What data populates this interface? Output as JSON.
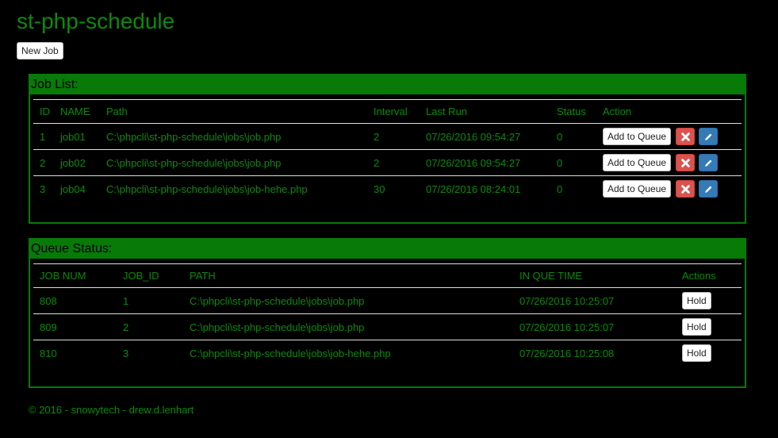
{
  "app": {
    "title": "st-php-schedule",
    "new_job_label": "New Job"
  },
  "job_list": {
    "heading": "Job List:",
    "columns": [
      "ID",
      "NAME",
      "Path",
      "Interval",
      "Last Run",
      "Status",
      "Action"
    ],
    "rows": [
      {
        "id": "1",
        "name": "job01",
        "path": "C:\\phpcli\\st-php-schedule\\jobs\\job.php",
        "interval": "2",
        "last_run": "07/26/2016 09:54:27",
        "status": "0",
        "add_label": "Add to Queue"
      },
      {
        "id": "2",
        "name": "job02",
        "path": "C:\\phpcli\\st-php-schedule\\jobs\\job.php",
        "interval": "2",
        "last_run": "07/26/2016 09:54:27",
        "status": "0",
        "add_label": "Add to Queue"
      },
      {
        "id": "3",
        "name": "job04",
        "path": "C:\\phpcli\\st-php-schedule\\jobs\\job-hehe.php",
        "interval": "30",
        "last_run": "07/26/2016 08:24:01",
        "status": "0",
        "add_label": "Add to Queue"
      }
    ]
  },
  "queue": {
    "heading": "Queue Status:",
    "columns": [
      "JOB NUM",
      "JOB_ID",
      "PATH",
      "IN QUE TIME",
      "Actions"
    ],
    "rows": [
      {
        "job_num": "808",
        "job_id": "1",
        "path": "C:\\phpcli\\st-php-schedule\\jobs\\job.php",
        "time": "07/26/2016 10:25:07",
        "hold_label": "Hold"
      },
      {
        "job_num": "809",
        "job_id": "2",
        "path": "C:\\phpcli\\st-php-schedule\\jobs\\job.php",
        "time": "07/26/2016 10:25:07",
        "hold_label": "Hold"
      },
      {
        "job_num": "810",
        "job_id": "3",
        "path": "C:\\phpcli\\st-php-schedule\\jobs\\job-hehe.php",
        "time": "07/26/2016 10:25:08",
        "hold_label": "Hold"
      }
    ]
  },
  "footer": {
    "text": "© 2016 - snowytech - drew.d.lenhart"
  },
  "icons": {
    "delete": "remove-icon",
    "edit": "pencil-icon"
  },
  "colors": {
    "text": "#0a8a0a",
    "panel": "#077a07",
    "delete": "#d9534f",
    "edit": "#337ab7"
  }
}
